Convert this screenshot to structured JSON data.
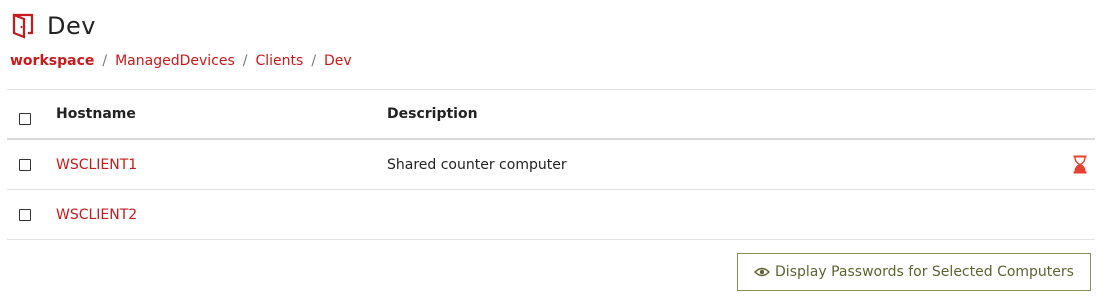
{
  "page": {
    "title": "Dev",
    "title_icon": "door-icon"
  },
  "breadcrumb": [
    "workspace",
    "ManagedDevices",
    "Clients",
    "Dev"
  ],
  "breadcrumb_separator": "/",
  "table": {
    "columns": [
      "Hostname",
      "Description"
    ],
    "rows": [
      {
        "hostname": "WSCLIENT1",
        "description": "Shared counter computer",
        "status_icon": "hourglass-icon"
      },
      {
        "hostname": "WSCLIENT2",
        "description": ""
      }
    ]
  },
  "actions": {
    "display_passwords_label": "Display Passwords for Selected Computers",
    "display_passwords_icon": "eye-icon"
  },
  "colors": {
    "accent": "#c8191b",
    "button_text": "#5e6330",
    "button_border": "#8a8f5e"
  }
}
